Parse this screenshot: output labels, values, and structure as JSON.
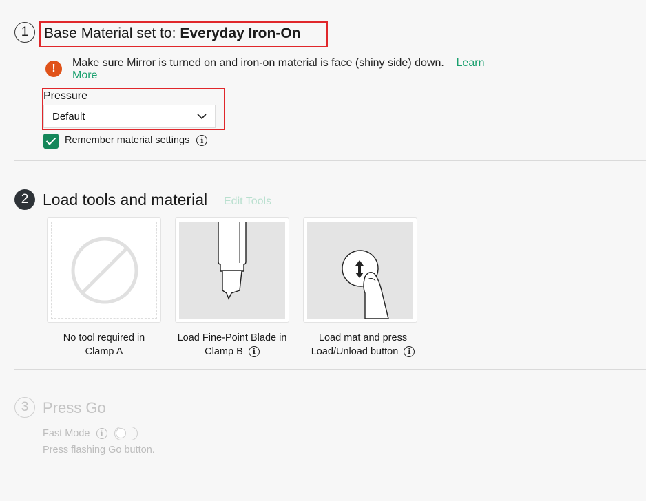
{
  "step1": {
    "number": "1",
    "title_prefix": "Base Material set to:",
    "material": "Everyday Iron-On",
    "warning_text": "Make sure Mirror is turned on and iron-on material is face (shiny side) down.",
    "learn_more_part1": "Learn",
    "learn_more_part2": "More",
    "pressure_label": "Pressure",
    "pressure_value": "Default",
    "remember_label": "Remember material settings",
    "remember_checked": true
  },
  "step2": {
    "number": "2",
    "title": "Load tools and material",
    "edit_tools_label": "Edit Tools",
    "cards": [
      {
        "caption_line1": "No tool required in",
        "caption_line2": "Clamp A",
        "icon": "no-tool-icon"
      },
      {
        "caption_line1": "Load Fine-Point Blade in",
        "caption_line2": "Clamp B",
        "icon": "fine-point-blade-image"
      },
      {
        "caption_line1": "Load mat and press",
        "caption_line2": "Load/Unload button",
        "icon": "load-unload-button-image"
      }
    ]
  },
  "step3": {
    "number": "3",
    "title": "Press Go",
    "fast_mode_label": "Fast Mode",
    "fast_mode_on": false,
    "instruction": "Press flashing Go button."
  },
  "colors": {
    "accent_green": "#15875a",
    "link_green": "#1aa06e",
    "warning_orange": "#e0531a",
    "highlight_red": "#e0272b"
  }
}
